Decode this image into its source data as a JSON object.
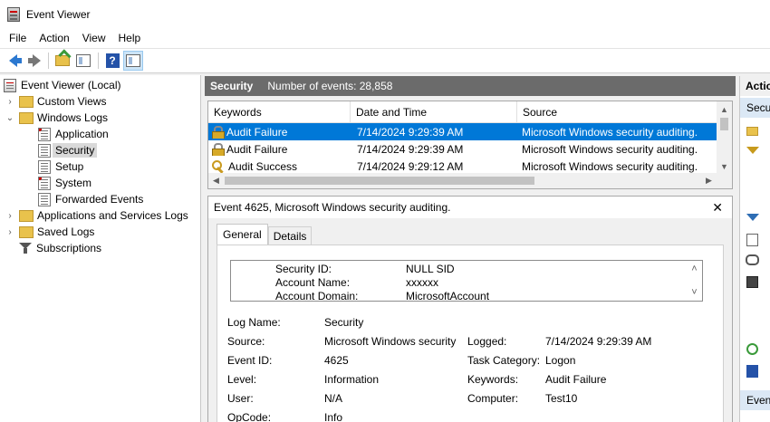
{
  "window": {
    "title": "Event Viewer"
  },
  "menu": [
    "File",
    "Action",
    "View",
    "Help"
  ],
  "tree": {
    "root": "Event Viewer (Local)",
    "custom_views": "Custom Views",
    "windows_logs": "Windows Logs",
    "application": "Application",
    "security": "Security",
    "setup": "Setup",
    "system": "System",
    "forwarded_events": "Forwarded Events",
    "apps_services": "Applications and Services Logs",
    "saved_logs": "Saved Logs",
    "subscriptions": "Subscriptions"
  },
  "center": {
    "log_name": "Security",
    "event_count": "Number of events: 28,858"
  },
  "columns": {
    "keywords": "Keywords",
    "date_time": "Date and Time",
    "source": "Source"
  },
  "events": [
    {
      "keyword": "Audit Failure",
      "datetime": "7/14/2024 9:29:39 AM",
      "source": "Microsoft Windows security auditing.",
      "icon": "lock-icon"
    },
    {
      "keyword": "Audit Failure",
      "datetime": "7/14/2024 9:29:39 AM",
      "source": "Microsoft Windows security auditing.",
      "icon": "lock-icon"
    },
    {
      "keyword": "Audit Success",
      "datetime": "7/14/2024 9:29:12 AM",
      "source": "Microsoft Windows security auditing.",
      "icon": "key-icon"
    }
  ],
  "detail": {
    "title": "Event 4625, Microsoft Windows security auditing.",
    "tab_general": "General",
    "tab_details": "Details",
    "message": [
      {
        "k": "Security ID:",
        "v": "NULL SID"
      },
      {
        "k": "Account Name:",
        "v": "xxxxxx"
      },
      {
        "k": "Account Domain:",
        "v": "MicrosoftAccount"
      }
    ],
    "labels": {
      "log_name": "Log Name:",
      "source": "Source:",
      "event_id": "Event ID:",
      "level": "Level:",
      "user": "User:",
      "opcode": "OpCode:",
      "logged": "Logged:",
      "task_category": "Task Category:",
      "keywords": "Keywords:",
      "computer": "Computer:"
    },
    "values": {
      "log_name": "Security",
      "source": "Microsoft Windows security",
      "event_id": "4625",
      "level": "Information",
      "user": "N/A",
      "opcode": "Info",
      "logged": "7/14/2024 9:29:39 AM",
      "task_category": "Logon",
      "keywords": "Audit Failure",
      "computer": "Test10"
    }
  },
  "actions": {
    "header": "Actio",
    "section_security": "Secu",
    "section_event": "Even"
  }
}
